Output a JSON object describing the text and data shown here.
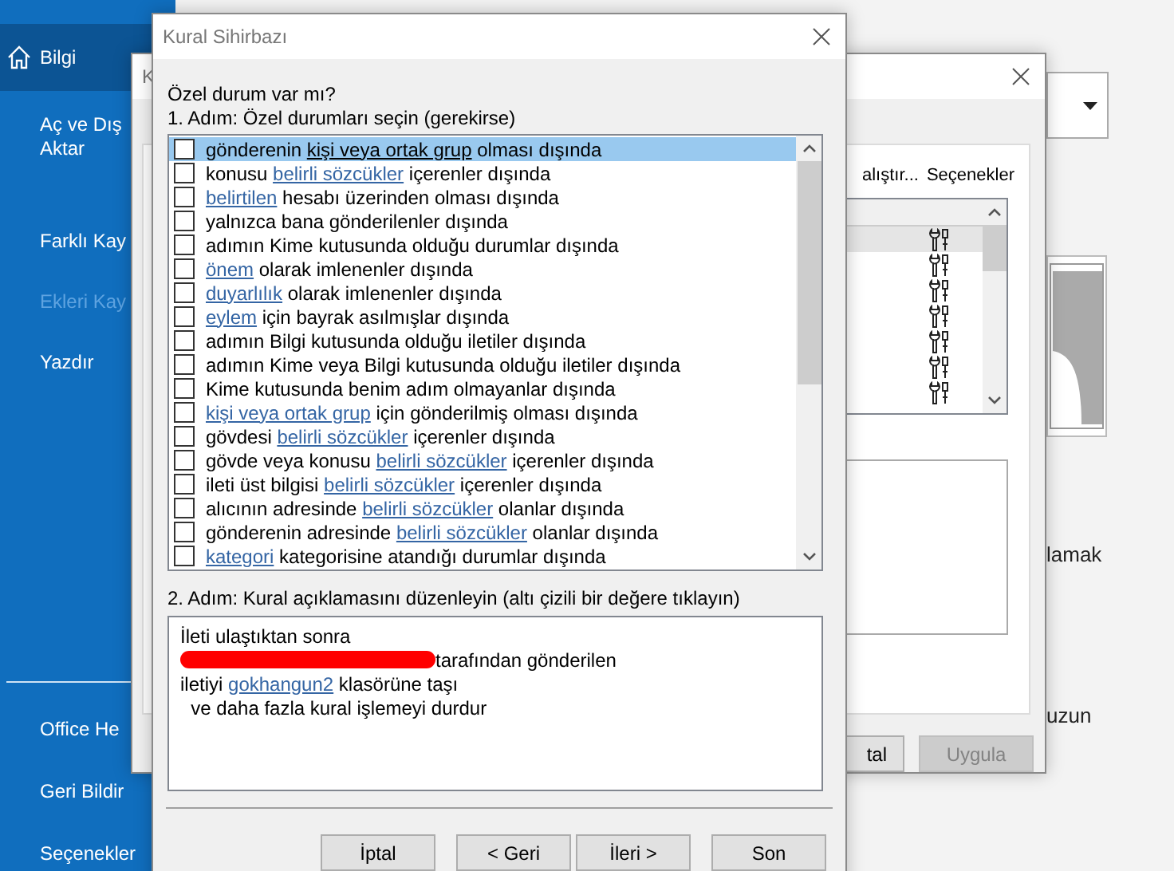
{
  "backstage": {
    "nav": [
      {
        "kind": "item",
        "lines": [
          "Bilgi"
        ],
        "selected": true,
        "disabled": false
      },
      {
        "kind": "item",
        "lines": [
          "Aç ve Dış",
          "Aktar"
        ],
        "selected": false,
        "disabled": false
      },
      {
        "kind": "item",
        "lines": [
          "Farklı Kay"
        ],
        "selected": false,
        "disabled": false
      },
      {
        "kind": "item",
        "lines": [
          "Ekleri Kay"
        ],
        "selected": false,
        "disabled": true
      },
      {
        "kind": "item",
        "lines": [
          "Yazdır"
        ],
        "selected": false,
        "disabled": false
      },
      {
        "kind": "separator"
      },
      {
        "kind": "item",
        "lines": [
          "Office He"
        ],
        "selected": false,
        "disabled": false
      },
      {
        "kind": "item",
        "lines": [
          "Geri Bildir"
        ],
        "selected": false,
        "disabled": false
      },
      {
        "kind": "item",
        "lines": [
          "Seçenekler"
        ],
        "selected": false,
        "disabled": false
      }
    ],
    "notes": [
      "lamak",
      "uzun"
    ]
  },
  "rules_window": {
    "title": "K",
    "toolbar": [
      "alıştır...",
      "Seçenekler"
    ],
    "rules": [
      {
        "selected": true
      },
      {
        "selected": false
      },
      {
        "selected": false
      },
      {
        "selected": false
      },
      {
        "selected": false
      },
      {
        "selected": false
      },
      {
        "selected": false
      }
    ],
    "buttons": [
      {
        "label": "tal",
        "disabled": false
      },
      {
        "label": "Uygula",
        "disabled": true
      }
    ]
  },
  "wizard": {
    "title": "Kural Sihirbazı",
    "question": "Özel durum var mı?",
    "step1": "1. Adım: Özel durumları seçin (gerekirse)",
    "conditions": [
      {
        "checked": false,
        "selected": true,
        "parts": [
          {
            "kind": "text",
            "text": "gönderenin "
          },
          {
            "kind": "link",
            "text": "kişi veya ortak grup"
          },
          {
            "kind": "text",
            "text": " olması dışında"
          }
        ]
      },
      {
        "checked": false,
        "selected": false,
        "parts": [
          {
            "kind": "text",
            "text": "konusu "
          },
          {
            "kind": "link",
            "text": "belirli sözcükler"
          },
          {
            "kind": "text",
            "text": " içerenler dışında"
          }
        ]
      },
      {
        "checked": false,
        "selected": false,
        "parts": [
          {
            "kind": "link",
            "text": "belirtilen"
          },
          {
            "kind": "text",
            "text": " hesabı üzerinden olması dışında"
          }
        ]
      },
      {
        "checked": false,
        "selected": false,
        "parts": [
          {
            "kind": "text",
            "text": "yalnızca bana gönderilenler dışında"
          }
        ]
      },
      {
        "checked": false,
        "selected": false,
        "parts": [
          {
            "kind": "text",
            "text": "adımın Kime kutusunda olduğu durumlar dışında"
          }
        ]
      },
      {
        "checked": false,
        "selected": false,
        "parts": [
          {
            "kind": "link",
            "text": "önem"
          },
          {
            "kind": "text",
            "text": " olarak imlenenler dışında"
          }
        ]
      },
      {
        "checked": false,
        "selected": false,
        "parts": [
          {
            "kind": "link",
            "text": "duyarlılık"
          },
          {
            "kind": "text",
            "text": " olarak imlenenler dışında"
          }
        ]
      },
      {
        "checked": false,
        "selected": false,
        "parts": [
          {
            "kind": "link",
            "text": "eylem"
          },
          {
            "kind": "text",
            "text": " için bayrak asılmışlar dışında"
          }
        ]
      },
      {
        "checked": false,
        "selected": false,
        "parts": [
          {
            "kind": "text",
            "text": "adımın Bilgi kutusunda olduğu iletiler dışında"
          }
        ]
      },
      {
        "checked": false,
        "selected": false,
        "parts": [
          {
            "kind": "text",
            "text": "adımın Kime veya Bilgi kutusunda olduğu iletiler dışında"
          }
        ]
      },
      {
        "checked": false,
        "selected": false,
        "parts": [
          {
            "kind": "text",
            "text": "Kime kutusunda benim adım olmayanlar dışında"
          }
        ]
      },
      {
        "checked": false,
        "selected": false,
        "parts": [
          {
            "kind": "link",
            "text": "kişi veya ortak grup"
          },
          {
            "kind": "text",
            "text": " için gönderilmiş olması dışında"
          }
        ]
      },
      {
        "checked": false,
        "selected": false,
        "parts": [
          {
            "kind": "text",
            "text": "gövdesi "
          },
          {
            "kind": "link",
            "text": "belirli sözcükler"
          },
          {
            "kind": "text",
            "text": " içerenler dışında"
          }
        ]
      },
      {
        "checked": false,
        "selected": false,
        "parts": [
          {
            "kind": "text",
            "text": "gövde veya konusu "
          },
          {
            "kind": "link",
            "text": "belirli sözcükler"
          },
          {
            "kind": "text",
            "text": " içerenler dışında"
          }
        ]
      },
      {
        "checked": false,
        "selected": false,
        "parts": [
          {
            "kind": "text",
            "text": "ileti üst bilgisi "
          },
          {
            "kind": "link",
            "text": "belirli sözcükler"
          },
          {
            "kind": "text",
            "text": " içerenler dışında"
          }
        ]
      },
      {
        "checked": false,
        "selected": false,
        "parts": [
          {
            "kind": "text",
            "text": "alıcının adresinde "
          },
          {
            "kind": "link",
            "text": "belirli sözcükler"
          },
          {
            "kind": "text",
            "text": " olanlar dışında"
          }
        ]
      },
      {
        "checked": false,
        "selected": false,
        "parts": [
          {
            "kind": "text",
            "text": "gönderenin adresinde "
          },
          {
            "kind": "link",
            "text": "belirli sözcükler"
          },
          {
            "kind": "text",
            "text": " olanlar dışında"
          }
        ]
      },
      {
        "checked": false,
        "selected": false,
        "parts": [
          {
            "kind": "link",
            "text": "kategori"
          },
          {
            "kind": "text",
            "text": " kategorisine atandığı durumlar dışında"
          }
        ]
      }
    ],
    "step2": "2. Adım: Kural açıklamasını düzenleyin (altı çizili bir değere tıklayın)",
    "description": [
      {
        "parts": [
          {
            "kind": "text",
            "text": "İleti ulaştıktan sonra"
          }
        ]
      },
      {
        "parts": [
          {
            "kind": "redacted"
          },
          {
            "kind": "text",
            "text": "tarafından gönderilen"
          }
        ]
      },
      {
        "parts": [
          {
            "kind": "text",
            "text": "iletiyi "
          },
          {
            "kind": "link",
            "text": "gokhangun2"
          },
          {
            "kind": "text",
            "text": " klasörüne taşı"
          }
        ]
      },
      {
        "parts": [
          {
            "kind": "text",
            "text": "  ve daha fazla kural işlemeyi durdur"
          }
        ]
      }
    ],
    "buttons": [
      "İptal",
      "< Geri",
      "İleri >",
      "Son"
    ]
  }
}
